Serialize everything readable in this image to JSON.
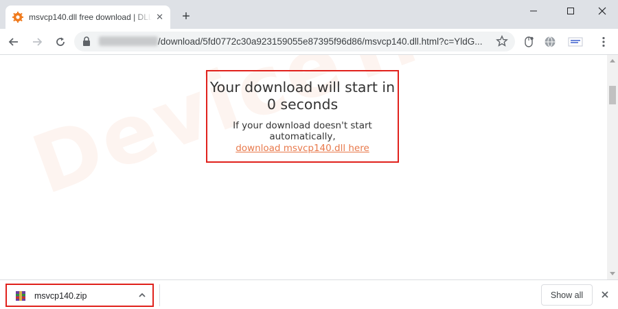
{
  "tab": {
    "title": "msvcp140.dll free download | DLL",
    "favicon": "gear-favicon-icon",
    "close_icon": "close-icon"
  },
  "window_controls": [
    "minimize-icon",
    "maximize-icon",
    "close-icon"
  ],
  "address_bar": {
    "url_path": "/download/5fd0772c30a923159055e87395f96d86/msvcp140.dll.html?c=YldG..."
  },
  "page": {
    "heading": "Your download will start in 0 seconds",
    "subtext": "If your download doesn't start automatically,",
    "link_text": "download msvcp140.dll here",
    "watermark": "DeviceTricks"
  },
  "download_shelf": {
    "file_name": "msvcp140.zip",
    "show_all_label": "Show all"
  },
  "colors": {
    "highlight_border": "#e0201b",
    "link": "#e8784a",
    "tab_strip": "#dee1e6"
  }
}
